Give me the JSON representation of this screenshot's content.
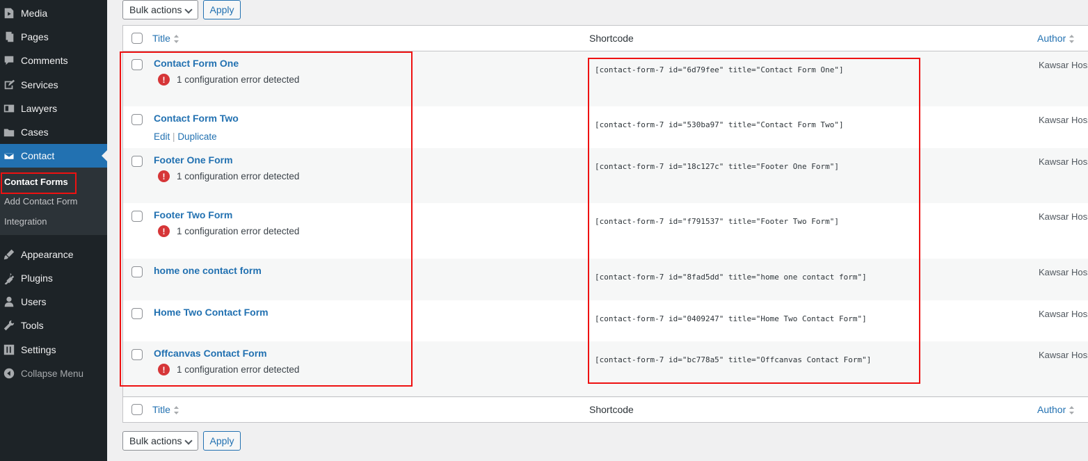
{
  "sidebar": {
    "items": [
      {
        "label": "Media",
        "icon": "media-icon"
      },
      {
        "label": "Pages",
        "icon": "pages-icon"
      },
      {
        "label": "Comments",
        "icon": "comments-icon"
      },
      {
        "label": "Services",
        "icon": "services-icon"
      },
      {
        "label": "Lawyers",
        "icon": "lawyers-icon"
      },
      {
        "label": "Cases",
        "icon": "cases-icon"
      },
      {
        "label": "Contact",
        "icon": "mail-icon"
      },
      {
        "label": "Appearance",
        "icon": "appearance-icon"
      },
      {
        "label": "Plugins",
        "icon": "plugins-icon"
      },
      {
        "label": "Users",
        "icon": "users-icon"
      },
      {
        "label": "Tools",
        "icon": "tools-icon"
      },
      {
        "label": "Settings",
        "icon": "settings-icon"
      },
      {
        "label": "Collapse Menu",
        "icon": "collapse-icon"
      }
    ],
    "submenu": [
      "Contact Forms",
      "Add Contact Form",
      "Integration"
    ]
  },
  "toolbar": {
    "bulk_label": "Bulk actions",
    "apply_label": "Apply"
  },
  "table": {
    "columns": {
      "title": "Title",
      "shortcode": "Shortcode",
      "author": "Author"
    },
    "rows": [
      {
        "title": "Contact Form One",
        "error": "1 configuration error detected",
        "shortcode": "[contact-form-7 id=\"6d79fee\" title=\"Contact Form One\"]",
        "author": "Kawsar Hossain"
      },
      {
        "title": "Contact Form Two",
        "actions": {
          "edit": "Edit",
          "sep": "|",
          "duplicate": "Duplicate"
        },
        "shortcode": "[contact-form-7 id=\"530ba97\" title=\"Contact Form Two\"]",
        "author": "Kawsar Hossain"
      },
      {
        "title": "Footer One Form",
        "error": "1 configuration error detected",
        "shortcode": "[contact-form-7 id=\"18c127c\" title=\"Footer One Form\"]",
        "author": "Kawsar Hossain"
      },
      {
        "title": "Footer Two Form",
        "error": "1 configuration error detected",
        "shortcode": "[contact-form-7 id=\"f791537\" title=\"Footer Two Form\"]",
        "author": "Kawsar Hossain"
      },
      {
        "title": "home one contact form",
        "shortcode": "[contact-form-7 id=\"8fad5dd\" title=\"home one contact form\"]",
        "author": "Kawsar Hossain"
      },
      {
        "title": "Home Two Contact Form",
        "shortcode": "[contact-form-7 id=\"0409247\" title=\"Home Two Contact Form\"]",
        "author": "Kawsar Hossain"
      },
      {
        "title": "Offcanvas Contact Form",
        "error": "1 configuration error detected",
        "shortcode": "[contact-form-7 id=\"bc778a5\" title=\"Offcanvas Contact Form\"]",
        "author": "Kawsar Hossain"
      }
    ]
  },
  "colors": {
    "sidebar_bg": "#1d2327",
    "active": "#2271b1",
    "link": "#2271b1",
    "error": "#d63638",
    "highlight_box": "#ee1111"
  }
}
